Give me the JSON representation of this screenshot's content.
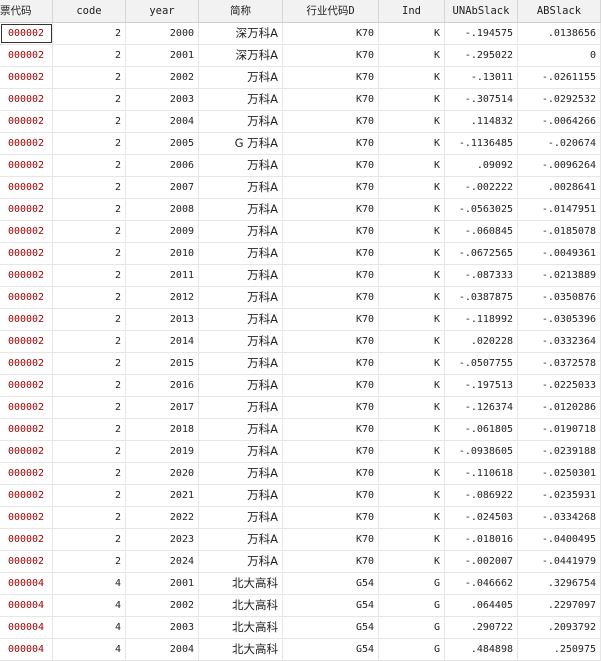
{
  "columns": [
    "票代码",
    "code",
    "year",
    "简称",
    "行业代码D",
    "Ind",
    "UNAbSlack",
    "ABSlack"
  ],
  "rows": [
    [
      "000002",
      "2",
      "2000",
      "深万科A",
      "K70",
      "K",
      "-.194575",
      ".0138656"
    ],
    [
      "000002",
      "2",
      "2001",
      "深万科A",
      "K70",
      "K",
      "-.295022",
      "0"
    ],
    [
      "000002",
      "2",
      "2002",
      "万科A",
      "K70",
      "K",
      "-.13011",
      "-.0261155"
    ],
    [
      "000002",
      "2",
      "2003",
      "万科A",
      "K70",
      "K",
      "-.307514",
      "-.0292532"
    ],
    [
      "000002",
      "2",
      "2004",
      "万科A",
      "K70",
      "K",
      ".114832",
      "-.0064266"
    ],
    [
      "000002",
      "2",
      "2005",
      "G 万科A",
      "K70",
      "K",
      "-.1136485",
      "-.020674"
    ],
    [
      "000002",
      "2",
      "2006",
      "万科A",
      "K70",
      "K",
      ".09092",
      "-.0096264"
    ],
    [
      "000002",
      "2",
      "2007",
      "万科A",
      "K70",
      "K",
      "-.002222",
      ".0028641"
    ],
    [
      "000002",
      "2",
      "2008",
      "万科A",
      "K70",
      "K",
      "-.0563025",
      "-.0147951"
    ],
    [
      "000002",
      "2",
      "2009",
      "万科A",
      "K70",
      "K",
      "-.060845",
      "-.0185078"
    ],
    [
      "000002",
      "2",
      "2010",
      "万科A",
      "K70",
      "K",
      "-.0672565",
      "-.0049361"
    ],
    [
      "000002",
      "2",
      "2011",
      "万科A",
      "K70",
      "K",
      "-.087333",
      "-.0213889"
    ],
    [
      "000002",
      "2",
      "2012",
      "万科A",
      "K70",
      "K",
      "-.0387875",
      "-.0350876"
    ],
    [
      "000002",
      "2",
      "2013",
      "万科A",
      "K70",
      "K",
      "-.118992",
      "-.0305396"
    ],
    [
      "000002",
      "2",
      "2014",
      "万科A",
      "K70",
      "K",
      ".020228",
      "-.0332364"
    ],
    [
      "000002",
      "2",
      "2015",
      "万科A",
      "K70",
      "K",
      "-.0507755",
      "-.0372578"
    ],
    [
      "000002",
      "2",
      "2016",
      "万科A",
      "K70",
      "K",
      "-.197513",
      "-.0225033"
    ],
    [
      "000002",
      "2",
      "2017",
      "万科A",
      "K70",
      "K",
      "-.126374",
      "-.0120286"
    ],
    [
      "000002",
      "2",
      "2018",
      "万科A",
      "K70",
      "K",
      "-.061805",
      "-.0190718"
    ],
    [
      "000002",
      "2",
      "2019",
      "万科A",
      "K70",
      "K",
      "-.0938605",
      "-.0239188"
    ],
    [
      "000002",
      "2",
      "2020",
      "万科A",
      "K70",
      "K",
      "-.110618",
      "-.0250301"
    ],
    [
      "000002",
      "2",
      "2021",
      "万科A",
      "K70",
      "K",
      "-.086922",
      "-.0235931"
    ],
    [
      "000002",
      "2",
      "2022",
      "万科A",
      "K70",
      "K",
      "-.024503",
      "-.0334268"
    ],
    [
      "000002",
      "2",
      "2023",
      "万科A",
      "K70",
      "K",
      "-.018016",
      "-.0400495"
    ],
    [
      "000002",
      "2",
      "2024",
      "万科A",
      "K70",
      "K",
      "-.002007",
      "-.0441979"
    ],
    [
      "000004",
      "4",
      "2001",
      "北大高科",
      "G54",
      "G",
      "-.046662",
      ".3296754"
    ],
    [
      "000004",
      "4",
      "2002",
      "北大高科",
      "G54",
      "G",
      ".064405",
      ".2297097"
    ],
    [
      "000004",
      "4",
      "2003",
      "北大高科",
      "G54",
      "G",
      ".290722",
      ".2093792"
    ],
    [
      "000004",
      "4",
      "2004",
      "北大高科",
      "G54",
      "G",
      ".484898",
      ".250975"
    ]
  ]
}
